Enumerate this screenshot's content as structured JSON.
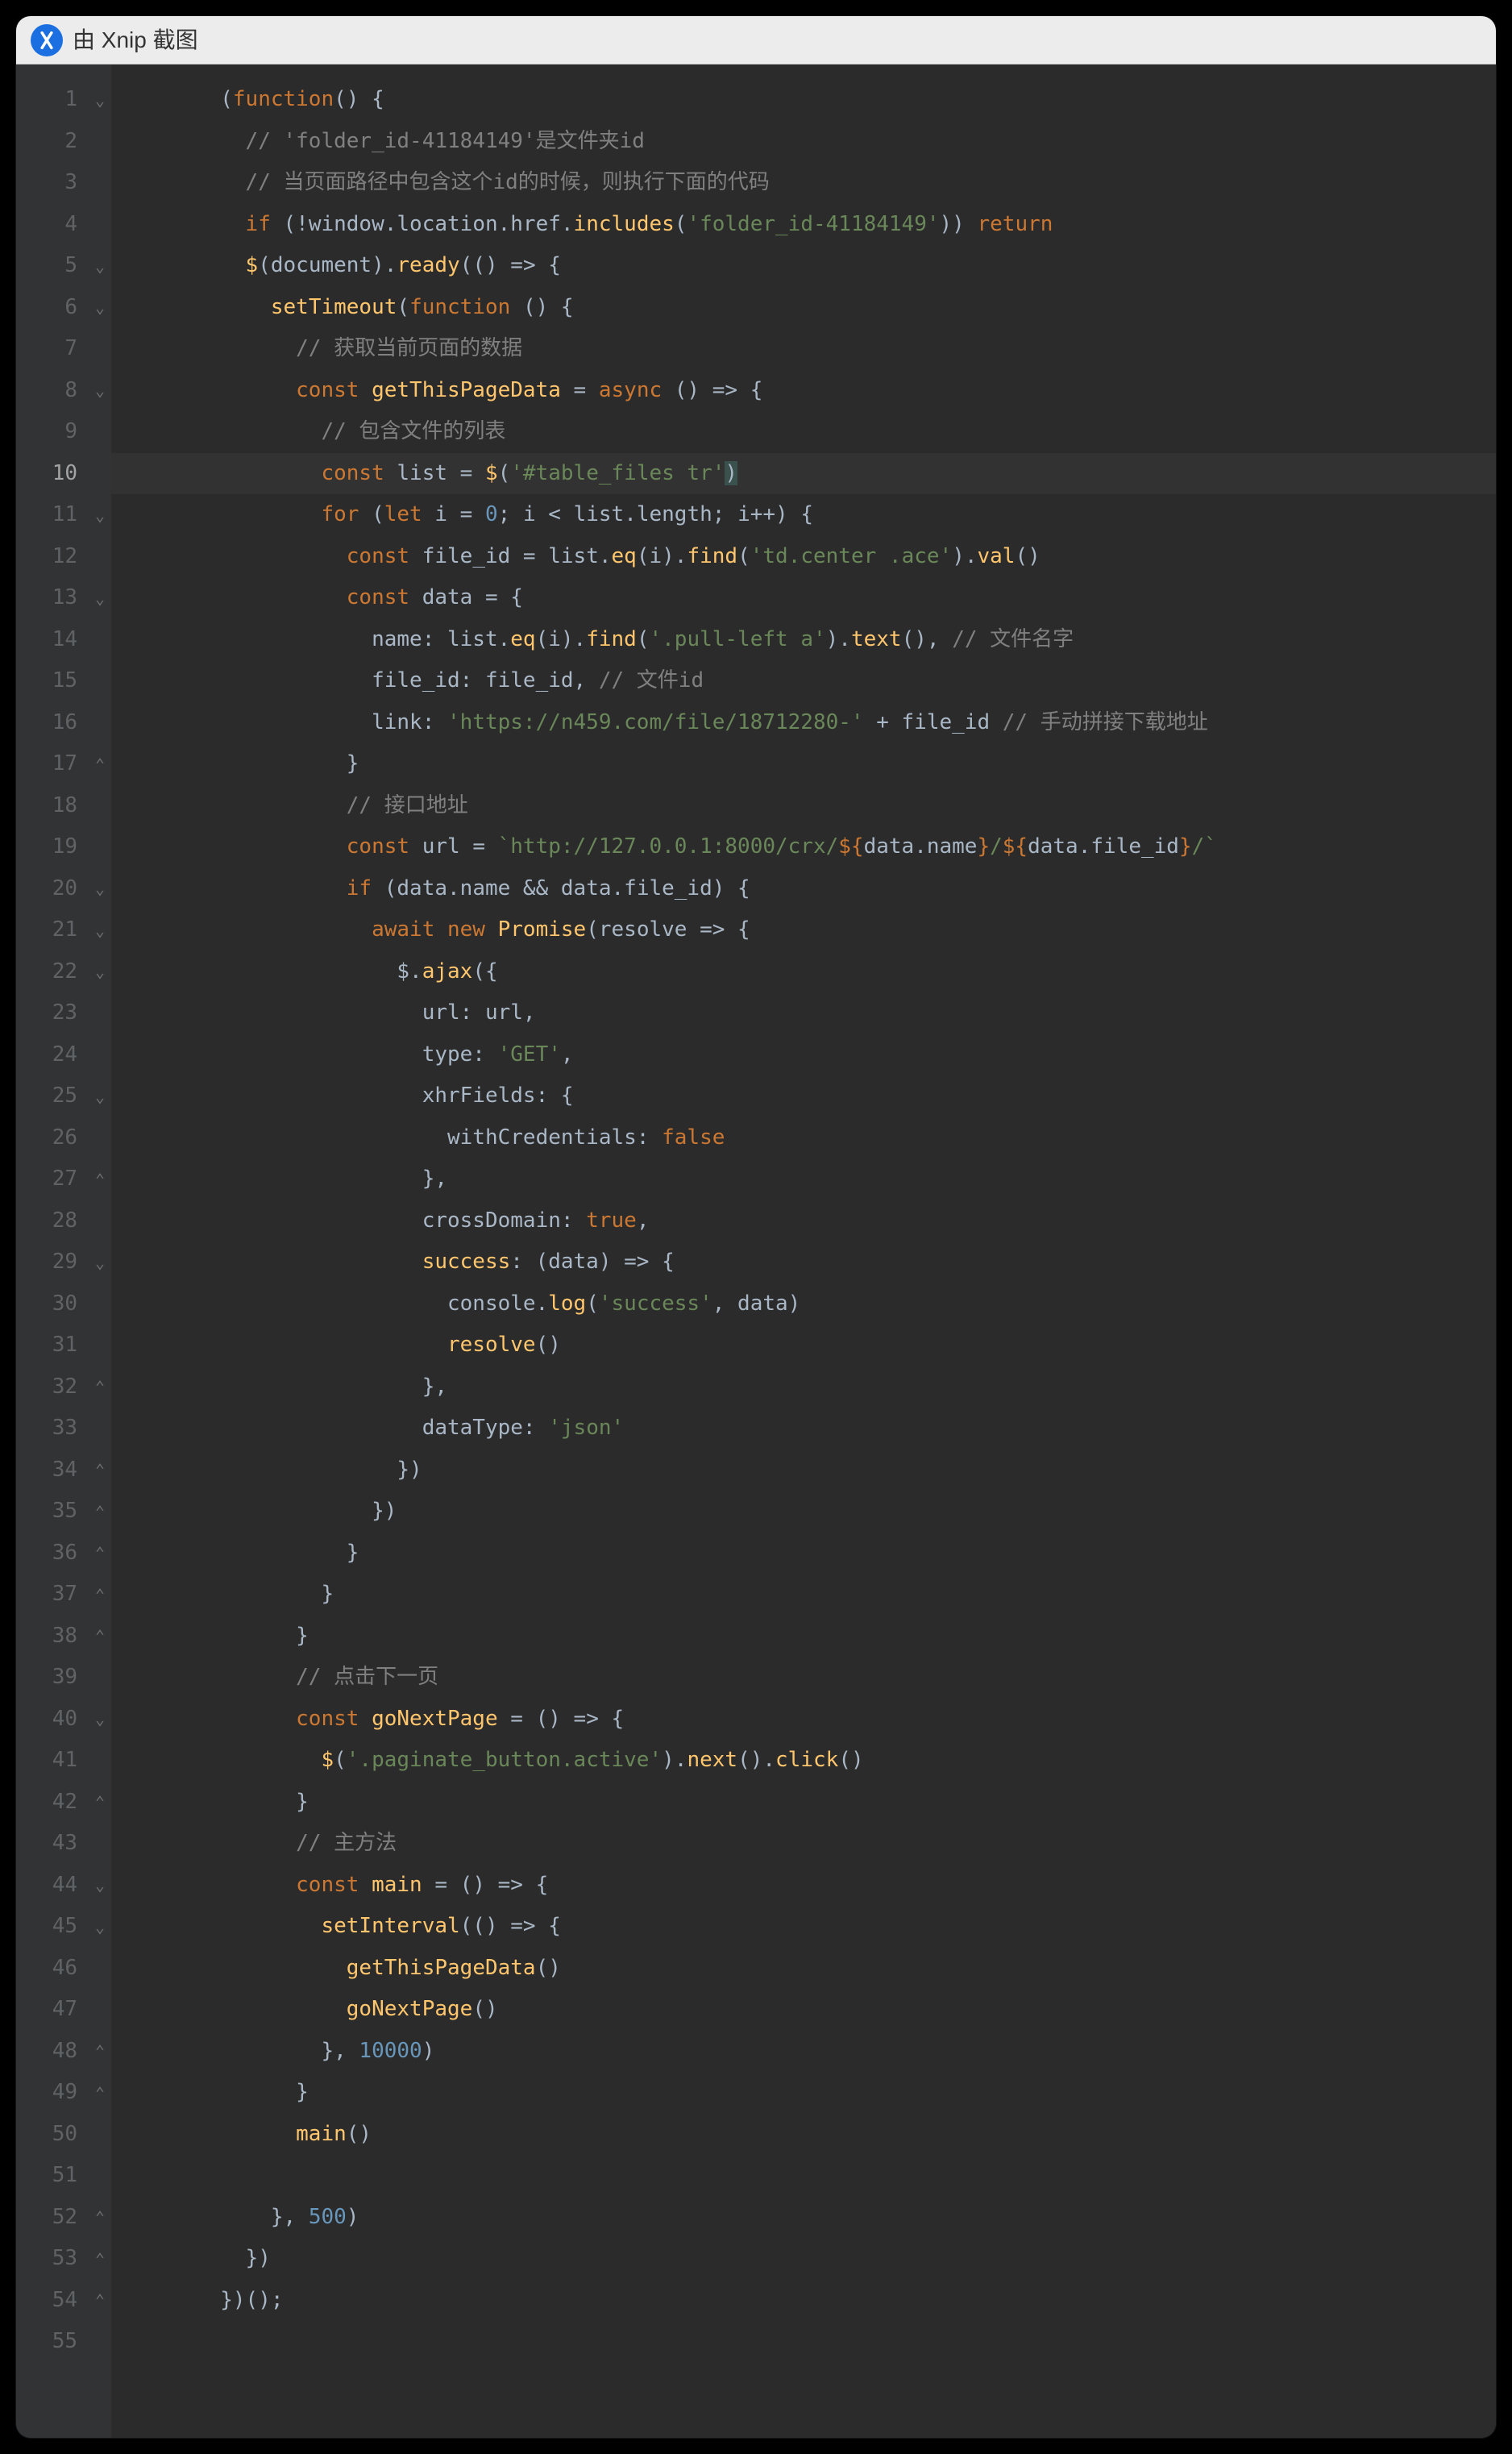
{
  "titlebar": {
    "text": "由 Xnip 截图"
  },
  "highlight_line": 10,
  "lines": [
    {
      "n": 1,
      "fold": "▾",
      "seg": [
        [
          "pun",
          "("
        ],
        [
          "kw",
          "function"
        ],
        [
          "pun",
          "() {"
        ]
      ]
    },
    {
      "n": 2,
      "seg": [
        [
          "cmt",
          "  // 'folder_id-41184149'是文件夹id"
        ]
      ]
    },
    {
      "n": 3,
      "seg": [
        [
          "cmt",
          "  // 当页面路径中包含这个id的时候，则执行下面的代码"
        ]
      ]
    },
    {
      "n": 4,
      "seg": [
        [
          "id",
          "  "
        ],
        [
          "kw",
          "if"
        ],
        [
          "pun",
          " (!window.location.href."
        ],
        [
          "fn",
          "includes"
        ],
        [
          "pun",
          "("
        ],
        [
          "str",
          "'folder_id-41184149'"
        ],
        [
          "pun",
          ")) "
        ],
        [
          "kw",
          "return"
        ]
      ]
    },
    {
      "n": 5,
      "fold": "▾",
      "seg": [
        [
          "id",
          "  "
        ],
        [
          "fn",
          "$"
        ],
        [
          "pun",
          "(document)."
        ],
        [
          "fn",
          "ready"
        ],
        [
          "pun",
          "(() => {"
        ]
      ]
    },
    {
      "n": 6,
      "fold": "▾",
      "seg": [
        [
          "id",
          "    "
        ],
        [
          "fn",
          "setTimeout"
        ],
        [
          "pun",
          "("
        ],
        [
          "kw",
          "function "
        ],
        [
          "pun",
          "() {"
        ]
      ]
    },
    {
      "n": 7,
      "seg": [
        [
          "cmt",
          "      // 获取当前页面的数据"
        ]
      ]
    },
    {
      "n": 8,
      "fold": "▾",
      "seg": [
        [
          "id",
          "      "
        ],
        [
          "kw",
          "const "
        ],
        [
          "fn",
          "getThisPageData"
        ],
        [
          "pun",
          " = "
        ],
        [
          "kw",
          "async "
        ],
        [
          "pun",
          "() => {"
        ]
      ]
    },
    {
      "n": 9,
      "seg": [
        [
          "cmt",
          "        // 包含文件的列表"
        ]
      ]
    },
    {
      "n": 10,
      "hl": true,
      "seg": [
        [
          "id",
          "        "
        ],
        [
          "kw",
          "const "
        ],
        [
          "id",
          "list = "
        ],
        [
          "fn",
          "$"
        ],
        [
          "pun",
          "("
        ],
        [
          "str",
          "'#table_files tr'"
        ],
        [
          "hlp",
          ")"
        ]
      ]
    },
    {
      "n": 11,
      "fold": "▾",
      "seg": [
        [
          "id",
          "        "
        ],
        [
          "kw",
          "for "
        ],
        [
          "pun",
          "("
        ],
        [
          "kw",
          "let "
        ],
        [
          "id",
          "i = "
        ],
        [
          "num",
          "0"
        ],
        [
          "pun",
          "; i < list.length; i++) {"
        ]
      ]
    },
    {
      "n": 12,
      "seg": [
        [
          "id",
          "          "
        ],
        [
          "kw",
          "const "
        ],
        [
          "id",
          "file_id = list."
        ],
        [
          "fn",
          "eq"
        ],
        [
          "pun",
          "(i)."
        ],
        [
          "fn",
          "find"
        ],
        [
          "pun",
          "("
        ],
        [
          "str",
          "'td.center .ace'"
        ],
        [
          "pun",
          ")."
        ],
        [
          "fn",
          "val"
        ],
        [
          "pun",
          "()"
        ]
      ]
    },
    {
      "n": 13,
      "fold": "▾",
      "seg": [
        [
          "id",
          "          "
        ],
        [
          "kw",
          "const "
        ],
        [
          "id",
          "data = {"
        ]
      ]
    },
    {
      "n": 14,
      "seg": [
        [
          "id",
          "            name: list."
        ],
        [
          "fn",
          "eq"
        ],
        [
          "pun",
          "(i)."
        ],
        [
          "fn",
          "find"
        ],
        [
          "pun",
          "("
        ],
        [
          "str",
          "'.pull-left a'"
        ],
        [
          "pun",
          ")."
        ],
        [
          "fn",
          "text"
        ],
        [
          "pun",
          "(), "
        ],
        [
          "cmt",
          "// 文件名字"
        ]
      ]
    },
    {
      "n": 15,
      "seg": [
        [
          "id",
          "            file_id: file_id, "
        ],
        [
          "cmt",
          "// 文件id"
        ]
      ]
    },
    {
      "n": 16,
      "seg": [
        [
          "id",
          "            link: "
        ],
        [
          "str",
          "'https://n459.com/file/18712280-'"
        ],
        [
          "id",
          " + file_id "
        ],
        [
          "cmt",
          "// 手动拼接下载地址"
        ]
      ]
    },
    {
      "n": 17,
      "fold": "▴",
      "seg": [
        [
          "id",
          "          }"
        ]
      ]
    },
    {
      "n": 18,
      "seg": [
        [
          "cmt",
          "          // 接口地址"
        ]
      ]
    },
    {
      "n": 19,
      "seg": [
        [
          "id",
          "          "
        ],
        [
          "kw",
          "const "
        ],
        [
          "id",
          "url = "
        ],
        [
          "tpl",
          "`http://127.0.0.1:8000/crx/"
        ],
        [
          "kw",
          "${"
        ],
        [
          "id",
          "data.name"
        ],
        [
          "kw",
          "}"
        ],
        [
          "tpl",
          "/"
        ],
        [
          "kw",
          "${"
        ],
        [
          "id",
          "data.file_id"
        ],
        [
          "kw",
          "}"
        ],
        [
          "tpl",
          "/`"
        ]
      ]
    },
    {
      "n": 20,
      "fold": "▾",
      "seg": [
        [
          "id",
          "          "
        ],
        [
          "kw",
          "if "
        ],
        [
          "pun",
          "(data.name && data.file_id) {"
        ]
      ]
    },
    {
      "n": 21,
      "fold": "▾",
      "seg": [
        [
          "id",
          "            "
        ],
        [
          "kw",
          "await new "
        ],
        [
          "fn",
          "Promise"
        ],
        [
          "pun",
          "(resolve => {"
        ]
      ]
    },
    {
      "n": 22,
      "fold": "▾",
      "seg": [
        [
          "id",
          "              $."
        ],
        [
          "fn",
          "ajax"
        ],
        [
          "pun",
          "({"
        ]
      ]
    },
    {
      "n": 23,
      "seg": [
        [
          "id",
          "                url: url,"
        ]
      ]
    },
    {
      "n": 24,
      "seg": [
        [
          "id",
          "                type: "
        ],
        [
          "str",
          "'GET'"
        ],
        [
          "pun",
          ","
        ]
      ]
    },
    {
      "n": 25,
      "fold": "▾",
      "seg": [
        [
          "id",
          "                xhrFields: {"
        ]
      ]
    },
    {
      "n": 26,
      "seg": [
        [
          "id",
          "                  withCredentials: "
        ],
        [
          "bool",
          "false"
        ]
      ]
    },
    {
      "n": 27,
      "fold": "▴",
      "seg": [
        [
          "id",
          "                },"
        ]
      ]
    },
    {
      "n": 28,
      "seg": [
        [
          "id",
          "                crossDomain: "
        ],
        [
          "bool",
          "true"
        ],
        [
          "pun",
          ","
        ]
      ]
    },
    {
      "n": 29,
      "fold": "▾",
      "seg": [
        [
          "id",
          "                "
        ],
        [
          "fn",
          "success"
        ],
        [
          "pun",
          ": (data) => {"
        ]
      ]
    },
    {
      "n": 30,
      "seg": [
        [
          "id",
          "                  console."
        ],
        [
          "fn",
          "log"
        ],
        [
          "pun",
          "("
        ],
        [
          "str",
          "'success'"
        ],
        [
          "pun",
          ", data)"
        ]
      ]
    },
    {
      "n": 31,
      "seg": [
        [
          "id",
          "                  "
        ],
        [
          "fn",
          "resolve"
        ],
        [
          "pun",
          "()"
        ]
      ]
    },
    {
      "n": 32,
      "fold": "▴",
      "seg": [
        [
          "id",
          "                },"
        ]
      ]
    },
    {
      "n": 33,
      "seg": [
        [
          "id",
          "                dataType: "
        ],
        [
          "str",
          "'json'"
        ]
      ]
    },
    {
      "n": 34,
      "fold": "▴",
      "seg": [
        [
          "id",
          "              })"
        ]
      ]
    },
    {
      "n": 35,
      "fold": "▴",
      "seg": [
        [
          "id",
          "            })"
        ]
      ]
    },
    {
      "n": 36,
      "fold": "▴",
      "seg": [
        [
          "id",
          "          }"
        ]
      ]
    },
    {
      "n": 37,
      "fold": "▴",
      "seg": [
        [
          "id",
          "        }"
        ]
      ]
    },
    {
      "n": 38,
      "fold": "▴",
      "seg": [
        [
          "id",
          "      }"
        ]
      ]
    },
    {
      "n": 39,
      "seg": [
        [
          "cmt",
          "      // 点击下一页"
        ]
      ]
    },
    {
      "n": 40,
      "fold": "▾",
      "seg": [
        [
          "id",
          "      "
        ],
        [
          "kw",
          "const "
        ],
        [
          "fn",
          "goNextPage"
        ],
        [
          "pun",
          " = () => {"
        ]
      ]
    },
    {
      "n": 41,
      "seg": [
        [
          "id",
          "        "
        ],
        [
          "fn",
          "$"
        ],
        [
          "pun",
          "("
        ],
        [
          "str",
          "'.paginate_button.active'"
        ],
        [
          "pun",
          ")."
        ],
        [
          "fn",
          "next"
        ],
        [
          "pun",
          "()."
        ],
        [
          "fn",
          "click"
        ],
        [
          "pun",
          "()"
        ]
      ]
    },
    {
      "n": 42,
      "fold": "▴",
      "seg": [
        [
          "id",
          "      }"
        ]
      ]
    },
    {
      "n": 43,
      "seg": [
        [
          "cmt",
          "      // 主方法"
        ]
      ]
    },
    {
      "n": 44,
      "fold": "▾",
      "seg": [
        [
          "id",
          "      "
        ],
        [
          "kw",
          "const "
        ],
        [
          "fn",
          "main"
        ],
        [
          "pun",
          " = () => {"
        ]
      ]
    },
    {
      "n": 45,
      "fold": "▾",
      "seg": [
        [
          "id",
          "        "
        ],
        [
          "fn",
          "setInterval"
        ],
        [
          "pun",
          "(() => {"
        ]
      ]
    },
    {
      "n": 46,
      "seg": [
        [
          "id",
          "          "
        ],
        [
          "fn",
          "getThisPageData"
        ],
        [
          "pun",
          "()"
        ]
      ]
    },
    {
      "n": 47,
      "seg": [
        [
          "id",
          "          "
        ],
        [
          "fn",
          "goNextPage"
        ],
        [
          "pun",
          "()"
        ]
      ]
    },
    {
      "n": 48,
      "fold": "▴",
      "seg": [
        [
          "id",
          "        }, "
        ],
        [
          "num",
          "10000"
        ],
        [
          "pun",
          ")"
        ]
      ]
    },
    {
      "n": 49,
      "fold": "▴",
      "seg": [
        [
          "id",
          "      }"
        ]
      ]
    },
    {
      "n": 50,
      "seg": [
        [
          "id",
          "      "
        ],
        [
          "fn",
          "main"
        ],
        [
          "pun",
          "()"
        ]
      ]
    },
    {
      "n": 51,
      "seg": [
        [
          "id",
          ""
        ]
      ]
    },
    {
      "n": 52,
      "fold": "▴",
      "seg": [
        [
          "id",
          "    }, "
        ],
        [
          "num",
          "500"
        ],
        [
          "pun",
          ")"
        ]
      ]
    },
    {
      "n": 53,
      "fold": "▴",
      "seg": [
        [
          "id",
          "  })"
        ]
      ]
    },
    {
      "n": 54,
      "fold": "▴",
      "seg": [
        [
          "id",
          "})();"
        ]
      ]
    },
    {
      "n": 55,
      "seg": [
        [
          "id",
          ""
        ]
      ]
    }
  ]
}
